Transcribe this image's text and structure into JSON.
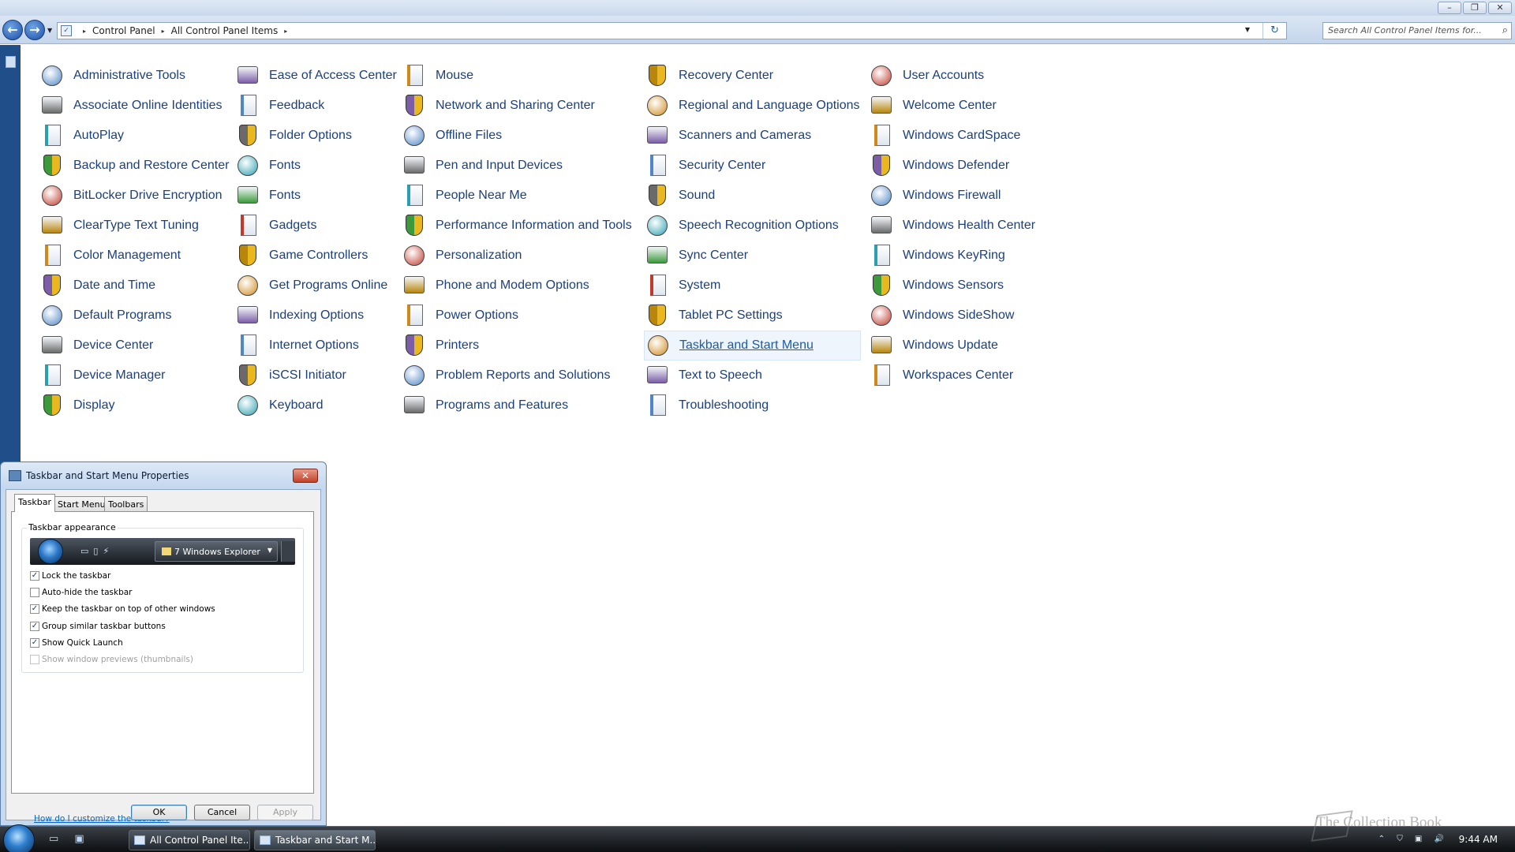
{
  "window": {
    "caption_buttons": [
      "–",
      "❐",
      "✕"
    ]
  },
  "nav": {
    "back_glyph": "←",
    "forward_glyph": "→",
    "recent_glyph": "▼"
  },
  "address": {
    "crumbs": [
      "Control Panel",
      "All Control Panel Items"
    ],
    "separator": "▸",
    "dropdown_glyph": "▼",
    "refresh_glyph": "↻"
  },
  "search": {
    "placeholder": "Search All Control Panel Items for...",
    "icon": "search-icon"
  },
  "control_panel": {
    "columns": [
      [
        "Administrative Tools",
        "Associate Online Identities",
        "AutoPlay",
        "Backup and Restore Center",
        "BitLocker Drive Encryption",
        "ClearType Text Tuning",
        "Color Management",
        "Date and Time",
        "Default Programs",
        "Device Center",
        "Device Manager",
        "Display"
      ],
      [
        "Ease of Access Center",
        "Feedback",
        "Folder Options",
        "Fonts",
        "Fonts",
        "Gadgets",
        "Game Controllers",
        "Get Programs Online",
        "Indexing Options",
        "Internet Options",
        "iSCSI Initiator",
        "Keyboard"
      ],
      [
        "Mouse",
        "Network and Sharing Center",
        "Offline Files",
        "Pen and Input Devices",
        "People Near Me",
        "Performance Information and Tools",
        "Personalization",
        "Phone and Modem Options",
        "Power Options",
        "Printers",
        "Problem Reports and Solutions",
        "Programs and Features"
      ],
      [
        "Recovery Center",
        "Regional and Language Options",
        "Scanners and Cameras",
        "Security Center",
        "Sound",
        "Speech Recognition Options",
        "Sync Center",
        "System",
        "Tablet PC Settings",
        "Taskbar and Start Menu",
        "Text to Speech",
        "Troubleshooting"
      ],
      [
        "User Accounts",
        "Welcome Center",
        "Windows CardSpace",
        "Windows Defender",
        "Windows Firewall",
        "Windows Health Center",
        "Windows KeyRing",
        "Windows Sensors",
        "Windows SideShow",
        "Windows Update",
        "Workspaces Center"
      ]
    ],
    "hovered_item": "Taskbar and Start Menu"
  },
  "dialog": {
    "title": "Taskbar and Start Menu Properties",
    "close_glyph": "✕",
    "tabs": [
      "Taskbar",
      "Start Menu",
      "Toolbars"
    ],
    "active_tab": "Taskbar",
    "group_label": "Taskbar appearance",
    "preview": {
      "quicklaunch_glyphs": "▭▯⚡",
      "task_label": "7 Windows Explorer",
      "task_arrow": "▼"
    },
    "checkboxes": [
      {
        "label": "Lock the taskbar",
        "checked": true,
        "enabled": true
      },
      {
        "label": "Auto-hide the taskbar",
        "checked": false,
        "enabled": true
      },
      {
        "label": "Keep the taskbar on top of other windows",
        "checked": true,
        "enabled": true
      },
      {
        "label": "Group similar taskbar buttons",
        "checked": true,
        "enabled": true
      },
      {
        "label": "Show Quick Launch",
        "checked": true,
        "enabled": true
      },
      {
        "label": "Show window previews (thumbnails)",
        "checked": false,
        "enabled": false
      }
    ],
    "check_glyph": "✓",
    "help_link": "How do I customize the taskbar?",
    "buttons": {
      "ok": "OK",
      "cancel": "Cancel",
      "apply": "Apply"
    }
  },
  "taskbar": {
    "quicklaunch_glyphs": "▭ ▣",
    "buttons": [
      {
        "label": "All Control Panel Ite...",
        "active": false
      },
      {
        "label": "Taskbar and Start M...",
        "active": true
      }
    ],
    "tray_glyphs": "⌃ ⛉ ▣ 🔊",
    "clock": "9:44 AM"
  },
  "watermark": "The Collection Book"
}
